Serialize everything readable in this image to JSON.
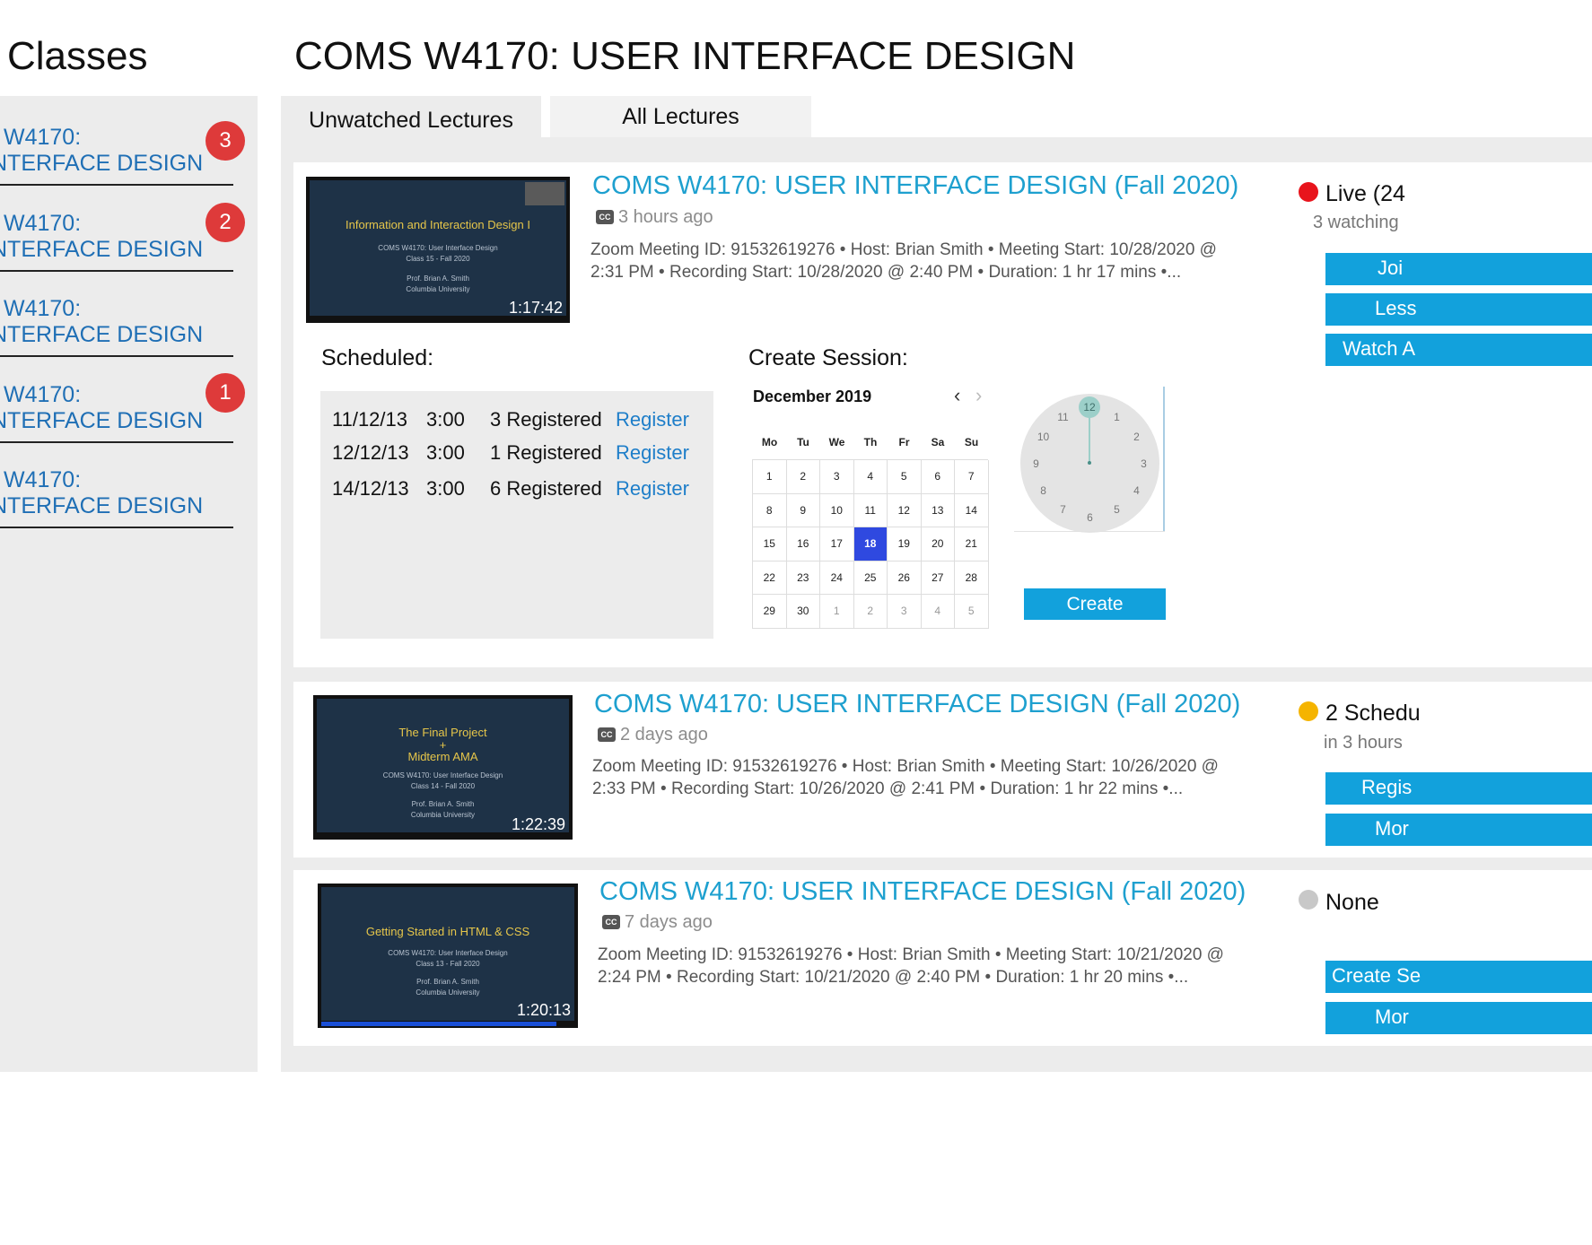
{
  "page": {
    "heading": "Classes",
    "course_title": "COMS W4170: USER INTERFACE DESIGN"
  },
  "sidebar": {
    "items": [
      {
        "line1": "W4170:",
        "line2": "NTERFACE DESIGN",
        "badge": "3"
      },
      {
        "line1": "W4170:",
        "line2": "NTERFACE DESIGN",
        "badge": "2"
      },
      {
        "line1": "W4170:",
        "line2": "NTERFACE DESIGN",
        "badge": ""
      },
      {
        "line1": "W4170:",
        "line2": "NTERFACE DESIGN",
        "badge": "1"
      },
      {
        "line1": "W4170:",
        "line2": "NTERFACE DESIGN",
        "badge": ""
      }
    ]
  },
  "tabs": {
    "unwatched": "Unwatched Lectures",
    "all": "All Lectures"
  },
  "lectures": [
    {
      "title": "COMS W4170: USER INTERFACE DESIGN (Fall 2020)",
      "cc": "CC",
      "ago": "3 hours ago",
      "meta_line1": "Zoom Meeting ID: 91532619276   • Host: Brian Smith   • Meeting Start: 10/28/2020 @",
      "meta_line2": "2:31 PM   • Recording Start: 10/28/2020 @ 2:40 PM   • Duration: 1 hr 17 mins   •...",
      "thumb": {
        "title": "Information and Interaction Design I",
        "sub1": "COMS W4170: User Interface Design",
        "sub2": "Class 15 - Fall 2020",
        "sub3": "Prof. Brian A. Smith",
        "sub4": "Columbia University",
        "duration": "1:17:42"
      },
      "status": {
        "label": "Live (24",
        "sub": "3 watching",
        "color": "#e8141c"
      },
      "buttons": [
        "Joi",
        "Less",
        "Watch A"
      ]
    },
    {
      "title": "COMS W4170: USER INTERFACE DESIGN (Fall 2020)",
      "cc": "CC",
      "ago": "2 days ago",
      "meta_line1": "Zoom Meeting ID: 91532619276   • Host: Brian Smith   • Meeting Start: 10/26/2020 @",
      "meta_line2": "2:33 PM   • Recording Start: 10/26/2020 @ 2:41 PM   • Duration: 1 hr 22 mins   •...",
      "thumb": {
        "title": "The Final Project",
        "title2": "+",
        "title3": "Midterm AMA",
        "sub1": "COMS W4170: User Interface Design",
        "sub2": "Class 14 - Fall 2020",
        "sub3": "Prof. Brian A. Smith",
        "sub4": "Columbia University",
        "duration": "1:22:39"
      },
      "status": {
        "label": "2 Schedu",
        "sub": "in 3 hours",
        "color": "#f5b400"
      },
      "buttons": [
        "Regis",
        "Mor"
      ]
    },
    {
      "title": "COMS W4170: USER INTERFACE DESIGN (Fall 2020)",
      "cc": "CC",
      "ago": "7 days ago",
      "meta_line1": "Zoom Meeting ID: 91532619276   • Host: Brian Smith   • Meeting Start: 10/21/2020 @",
      "meta_line2": "2:24 PM   • Recording Start: 10/21/2020 @ 2:40 PM   • Duration: 1 hr 20 mins   •...",
      "thumb": {
        "title": "Getting Started in HTML & CSS",
        "sub1": "COMS W4170: User Interface Design",
        "sub2": "Class 13 - Fall 2020",
        "sub3": "Prof. Brian A. Smith",
        "sub4": "Columbia University",
        "duration": "1:20:13",
        "watched_fraction": 0.93
      },
      "status": {
        "label": "None",
        "sub": "",
        "color": "#c8c8c8"
      },
      "buttons": [
        "Create Se",
        "Mor"
      ]
    }
  ],
  "scheduled": {
    "label": "Scheduled:",
    "rows": [
      {
        "date": "11/12/13",
        "time": "3:00",
        "registered": "3 Registered",
        "link": "Register"
      },
      {
        "date": "12/12/13",
        "time": "3:00",
        "registered": "1 Registered",
        "link": "Register"
      },
      {
        "date": "14/12/13",
        "time": "3:00",
        "registered": "6 Registered",
        "link": "Register"
      }
    ]
  },
  "create_session": {
    "label": "Create Session:",
    "calendar": {
      "month": "December 2019",
      "prev": "‹",
      "next": "›",
      "weekdays": [
        "Mo",
        "Tu",
        "We",
        "Th",
        "Fr",
        "Sa",
        "Su"
      ],
      "days": [
        "1",
        "2",
        "3",
        "4",
        "5",
        "6",
        "7",
        "8",
        "9",
        "10",
        "11",
        "12",
        "13",
        "14",
        "15",
        "16",
        "17",
        "18",
        "19",
        "20",
        "21",
        "22",
        "23",
        "24",
        "25",
        "26",
        "27",
        "28",
        "29",
        "30",
        "1",
        "2",
        "3",
        "4",
        "5"
      ],
      "selected": "18",
      "other_month_from": 30
    },
    "clock": {
      "selected": "12",
      "numbers": [
        "1",
        "2",
        "3",
        "4",
        "5",
        "6",
        "7",
        "8",
        "9",
        "10",
        "11"
      ]
    },
    "create_label": "Create"
  }
}
